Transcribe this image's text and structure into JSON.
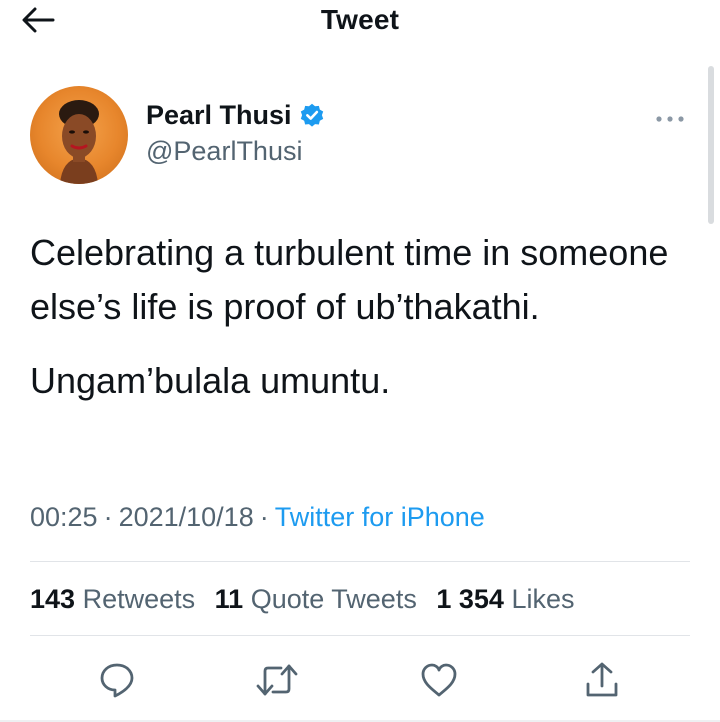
{
  "header": {
    "title": "Tweet",
    "back_icon": "arrow-left-icon"
  },
  "author": {
    "display_name": "Pearl Thusi",
    "handle": "@PearlThusi",
    "verified": true,
    "verified_color": "#1d9bf0"
  },
  "tweet": {
    "paragraphs": [
      "Celebrating a turbulent time in someone else’s life is proof of ub’thakathi.",
      "Ungam’bulala umuntu."
    ],
    "time": "00:25",
    "date": "2021/10/18",
    "separator": "·",
    "source": "Twitter for iPhone"
  },
  "stats": {
    "retweets_count": "143",
    "retweets_label": "Retweets",
    "quote_tweets_count": "11",
    "quote_tweets_label": "Quote Tweets",
    "likes_count": "1 354",
    "likes_label": "Likes"
  },
  "actions": [
    {
      "name": "reply",
      "icon": "reply-icon"
    },
    {
      "name": "retweet",
      "icon": "retweet-icon"
    },
    {
      "name": "like",
      "icon": "heart-icon"
    },
    {
      "name": "share",
      "icon": "share-icon"
    }
  ],
  "colors": {
    "text": "#0f1419",
    "secondary": "#536471",
    "link": "#1d9bf0",
    "divider": "#e1e4e8"
  }
}
